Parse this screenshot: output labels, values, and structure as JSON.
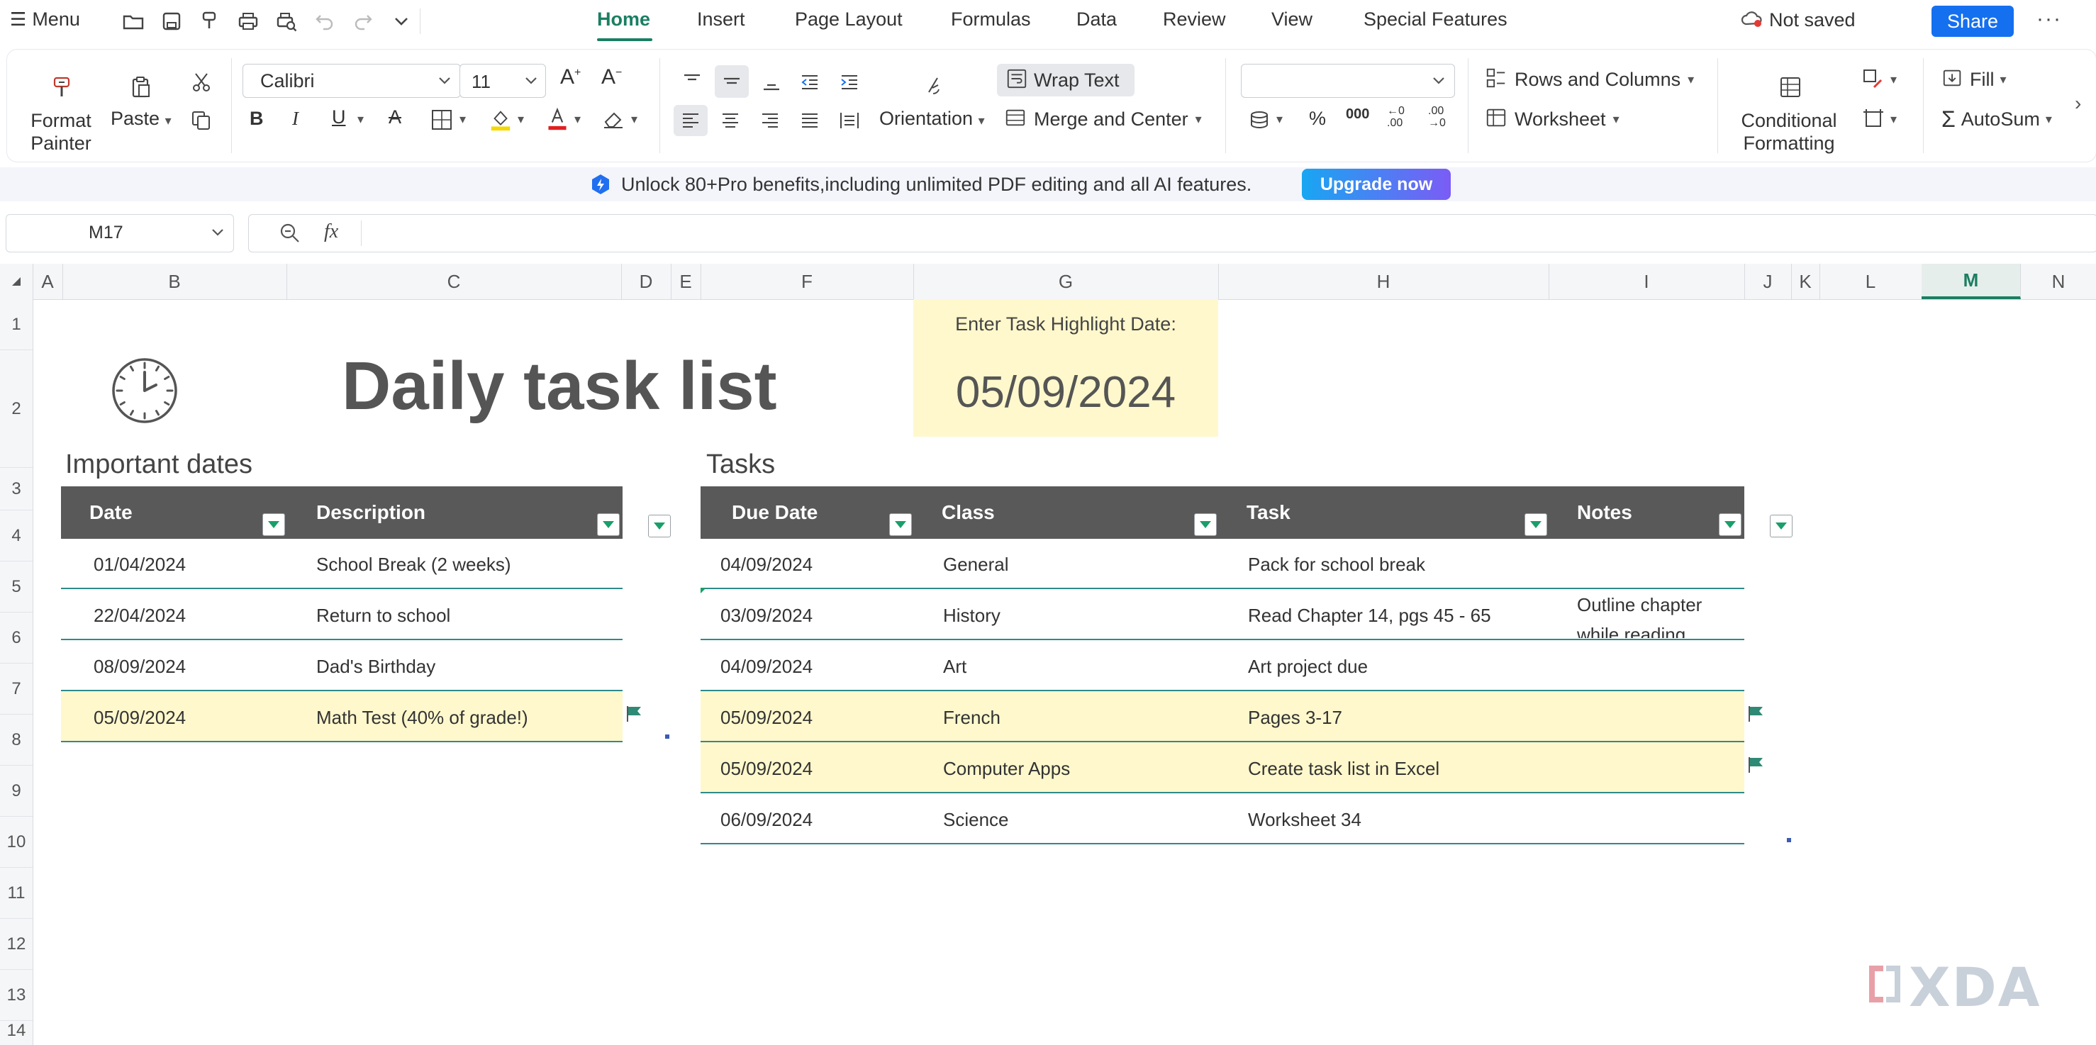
{
  "menubar": {
    "menu_label": "Menu",
    "tabs": [
      "Home",
      "Insert",
      "Page Layout",
      "Formulas",
      "Data",
      "Review",
      "View",
      "Special Features"
    ],
    "active_tab": "Home",
    "save_status": "Not saved",
    "share_label": "Share"
  },
  "ribbon": {
    "format_painter": "Format\nPainter",
    "paste": "Paste",
    "font_name": "Calibri",
    "font_size": "11",
    "orientation": "Orientation",
    "wrap_text": "Wrap Text",
    "merge_center": "Merge and Center",
    "number_format": "",
    "rows_columns": "Rows and Columns",
    "worksheet": "Worksheet",
    "conditional_formatting": "Conditional\nFormatting",
    "fill": "Fill",
    "autosum": "AutoSum",
    "colors": {
      "font_color": "#e02020",
      "highlight_color": "#f5d800",
      "accent": "#1a7f62"
    }
  },
  "promo": {
    "text": "Unlock 80+Pro benefits,including unlimited PDF editing and all AI features.",
    "button": "Upgrade now"
  },
  "formula_bar": {
    "name_box": "M17",
    "fx": "fx",
    "formula": ""
  },
  "grid": {
    "columns": [
      "A",
      "B",
      "C",
      "D",
      "E",
      "F",
      "G",
      "H",
      "I",
      "J",
      "K",
      "L",
      "M",
      "N"
    ],
    "selected_column": "M",
    "rows": [
      "1",
      "2",
      "3",
      "4",
      "5",
      "6",
      "7",
      "8",
      "9",
      "10",
      "11",
      "12",
      "13",
      "14"
    ]
  },
  "sheet": {
    "title": "Daily task list",
    "highlight_prompt": "Enter Task Highlight Date:",
    "highlight_date": "05/09/2024",
    "important_dates": {
      "heading": "Important dates",
      "headers": [
        "Date",
        "Description"
      ],
      "rows": [
        {
          "date": "01/04/2024",
          "description": "School Break (2 weeks)",
          "highlighted": false
        },
        {
          "date": "22/04/2024",
          "description": "Return to school",
          "highlighted": false
        },
        {
          "date": "08/09/2024",
          "description": "Dad's Birthday",
          "highlighted": false
        },
        {
          "date": "05/09/2024",
          "description": "Math Test (40% of grade!)",
          "highlighted": true
        }
      ]
    },
    "tasks": {
      "heading": "Tasks",
      "headers": [
        "Due Date",
        "Class",
        "Task",
        "Notes"
      ],
      "rows": [
        {
          "due": "04/09/2024",
          "class": "General",
          "task": "Pack for school break",
          "notes": "",
          "highlighted": false
        },
        {
          "due": "03/09/2024",
          "class": "History",
          "task": "Read Chapter 14, pgs 45 - 65",
          "notes": "Outline chapter while reading",
          "highlighted": false
        },
        {
          "due": "04/09/2024",
          "class": "Art",
          "task": "Art project due",
          "notes": "",
          "highlighted": false
        },
        {
          "due": "05/09/2024",
          "class": "French",
          "task": "Pages 3-17",
          "notes": "",
          "highlighted": true
        },
        {
          "due": "05/09/2024",
          "class": "Computer Apps",
          "task": "Create task list in Excel",
          "notes": "",
          "highlighted": true
        },
        {
          "due": "06/09/2024",
          "class": "Science",
          "task": "Worksheet 34",
          "notes": "",
          "highlighted": false
        }
      ]
    }
  },
  "watermark": "XDA"
}
